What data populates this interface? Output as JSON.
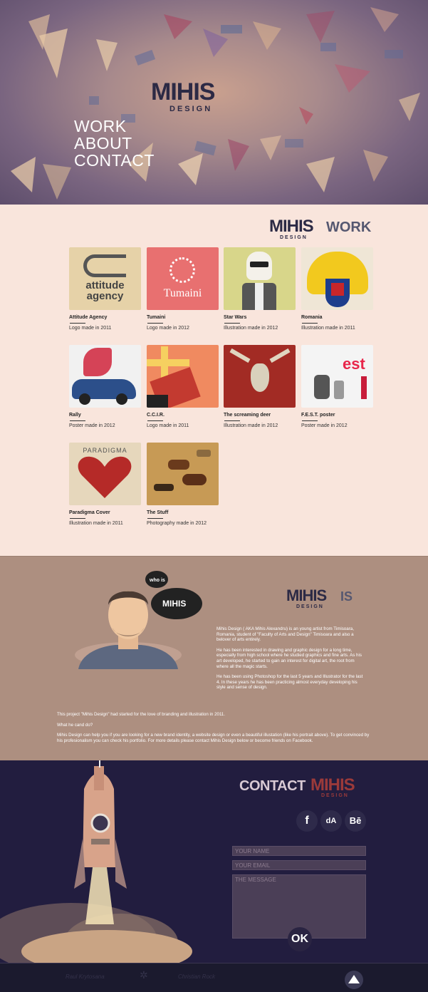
{
  "nav": {
    "work": "WORK",
    "about": "ABOUT",
    "contact": "CONTACT"
  },
  "brand": {
    "name": "MIHIS",
    "sub": "DESIGN"
  },
  "work": {
    "heading_brand": "MIHIS",
    "heading": "WORK",
    "items": [
      {
        "name": "Attitude Agency",
        "desc": "Logo made in 2011",
        "thumb_text": "attitude agency"
      },
      {
        "name": "Tumaini",
        "desc": "Logo made in 2012",
        "thumb_text": "Tumaini"
      },
      {
        "name": "Star Wars",
        "desc": "Illustration made in 2012"
      },
      {
        "name": "Romania",
        "desc": "Illustration made in 2011"
      },
      {
        "name": "Rally",
        "desc": "Poster made in 2012"
      },
      {
        "name": "C.C.I.R.",
        "desc": "Logo made in 2011"
      },
      {
        "name": "The screaming deer",
        "desc": "Illustration made in 2012"
      },
      {
        "name": "F.E.S.T. poster",
        "desc": "Poster made in 2012",
        "thumb_text": "est"
      },
      {
        "name": "Paradigma Cover",
        "desc": "Illustration made in 2011",
        "thumb_text": "PARADIGMA"
      },
      {
        "name": "The Stuff",
        "desc": "Photography made in 2012"
      }
    ]
  },
  "about": {
    "heading_brand": "MIHIS",
    "heading_suffix": "IS",
    "bubble_small": "who is",
    "paragraphs": [
      "Mihis Design ( AKA Mihis Alexandru) is an young artist from Timisoara, Romania, student of \"Faculty of Arts and Design\" Timisoara and also a belover of arts entirely.",
      "He has been interested in drawing and graphic design for a long time, especially from high school where he studied graphics and fine arts. As his art developed, he started to gain an interest for digital art, the root from where all the magic starts.",
      "He has been using Photoshop for the last 5 years and Illustrator for the last 4. In these years he has been practicing almost everyday developing his style and sense of design."
    ],
    "footer_paragraphs": [
      "This project \"Mihis Design\" had started for the love of branding and illustration in 2011.",
      "What he cand do?",
      "Mihis Design can help you if you are looking for a new brand identity, a website design or even a beautiful illustation (like his portrait above). To get convinced by his profesionalism you can check his portfolio. For more details please contact Mihis Design below or become friends on Facebook."
    ]
  },
  "contact": {
    "heading": "CONTACT",
    "heading_brand": "MIHIS",
    "social": {
      "facebook": "f",
      "deviantart": "dA",
      "behance": "Bē"
    },
    "name_placeholder": "YOUR NAME",
    "email_placeholder": "YOUR EMAIL",
    "message_placeholder": "THE MESSAGE",
    "submit": "OK"
  },
  "footer": {
    "credit1": "Raul Krytosana",
    "credit2": "Christian Rock"
  },
  "colors": {
    "hero_bg": "#a88a8c",
    "work_bg": "#f9e5dc",
    "about_bg": "#ad8f80",
    "contact_bg": "#221d3f",
    "brand_dark": "#2c2a45",
    "brand_red": "#9b3a3a"
  }
}
